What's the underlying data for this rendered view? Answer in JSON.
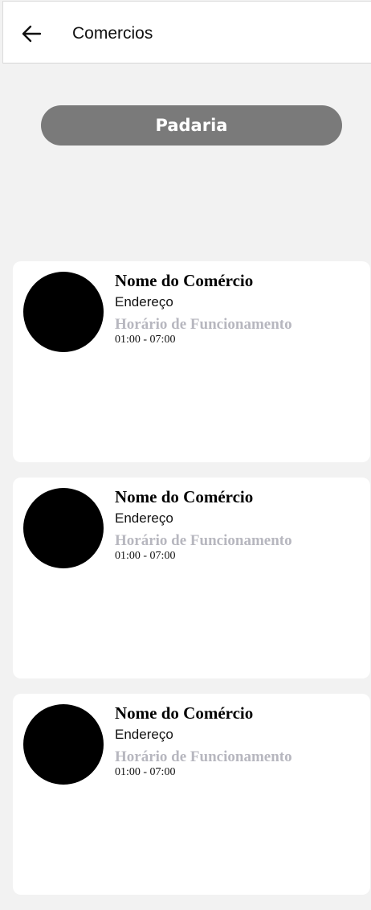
{
  "header": {
    "title": "Comercios",
    "back_icon": "arrow-left"
  },
  "category": {
    "label": "Padaria"
  },
  "shops": [
    {
      "name": "Nome do Comércio",
      "address": "Endereço",
      "hours_label": "Horário de Funcionamento",
      "hours": "01:00 - 07:00"
    },
    {
      "name": "Nome do Comércio",
      "address": "Endereço",
      "hours_label": "Horário de Funcionamento",
      "hours": "01:00 - 07:00"
    },
    {
      "name": "Nome do Comércio",
      "address": "Endereço",
      "hours_label": "Horário de Funcionamento",
      "hours": "01:00 - 07:00"
    }
  ],
  "colors": {
    "background": "#f2f2f2",
    "category_pill": "#7a7a7a",
    "hours_label": "#b7b7bf",
    "avatar": "#000000"
  }
}
